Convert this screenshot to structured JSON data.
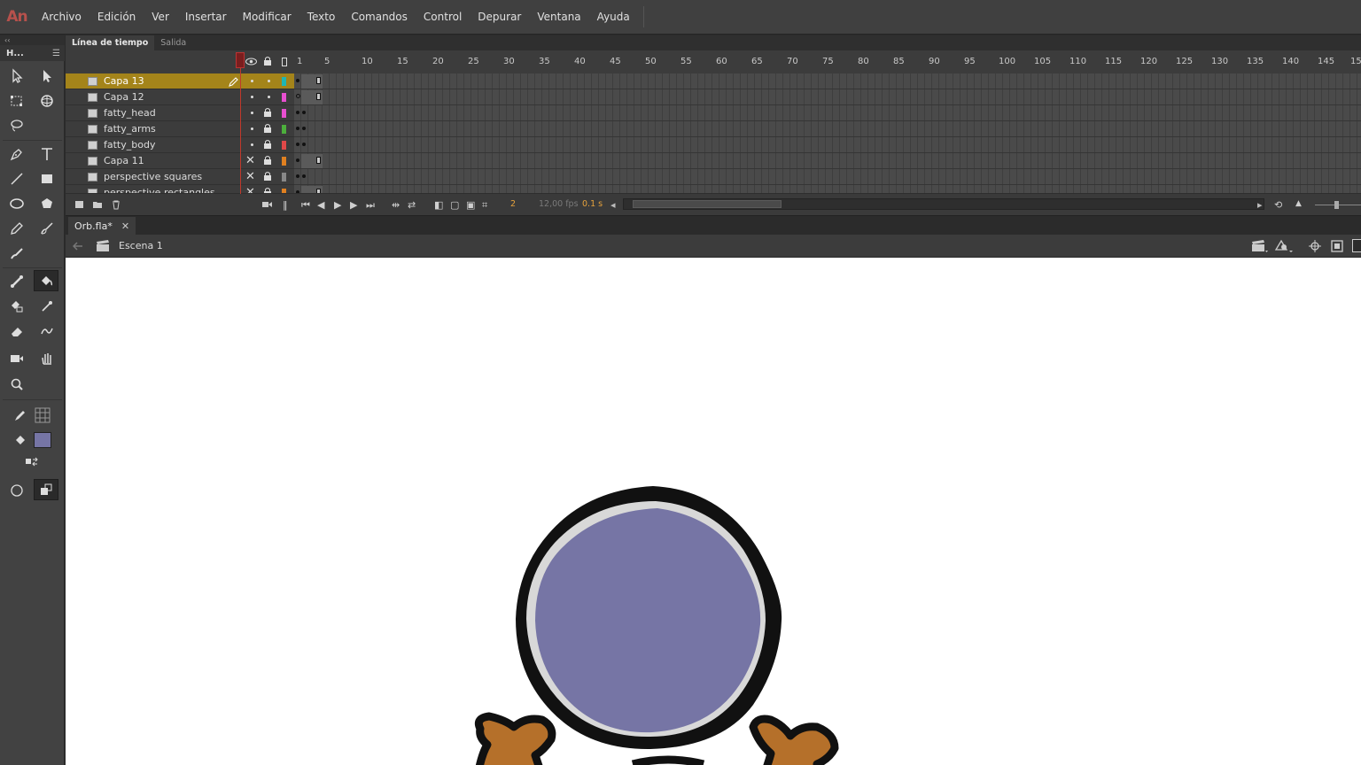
{
  "app": {
    "logo": "An"
  },
  "menu": [
    "Archivo",
    "Edición",
    "Ver",
    "Insertar",
    "Modificar",
    "Texto",
    "Comandos",
    "Control",
    "Depurar",
    "Ventana",
    "Ayuda"
  ],
  "toolbar": {
    "title": "H...",
    "collapse": "‹‹",
    "fill_color": "#7675a5"
  },
  "timeline": {
    "tabs": [
      "Línea de tiempo",
      "Salida"
    ],
    "ruler": [
      "1",
      "5",
      "10",
      "15",
      "20",
      "25",
      "30",
      "35",
      "40",
      "45",
      "50",
      "55",
      "60",
      "65",
      "70",
      "75",
      "80",
      "85",
      "90",
      "95",
      "100",
      "105",
      "110",
      "115",
      "120",
      "125",
      "130",
      "135",
      "140",
      "145",
      "15"
    ],
    "layers": [
      {
        "name": "Capa 13",
        "color": "#1fb5b5",
        "selected": true
      },
      {
        "name": "Capa 12",
        "color": "#e84fd0"
      },
      {
        "name": "fatty_head",
        "color": "#e84fd0"
      },
      {
        "name": "fatty_arms",
        "color": "#4caf3c"
      },
      {
        "name": "fatty_body",
        "color": "#e04848"
      },
      {
        "name": "Capa 11",
        "color": "#e08020"
      },
      {
        "name": "perspective squares",
        "color": "#888888"
      },
      {
        "name": "perspective rectangles",
        "color": "#e08020"
      }
    ],
    "current_frame": "2",
    "fps": "12,00 fps",
    "elapsed": "0.1 s"
  },
  "document": {
    "tab": "Orb.fla*",
    "close": "✕",
    "scene": "Escena 1"
  },
  "stage": {
    "orb_color": "#7675a5",
    "ring_color": "#d8d8d8",
    "arm_color": "#b5702a"
  }
}
